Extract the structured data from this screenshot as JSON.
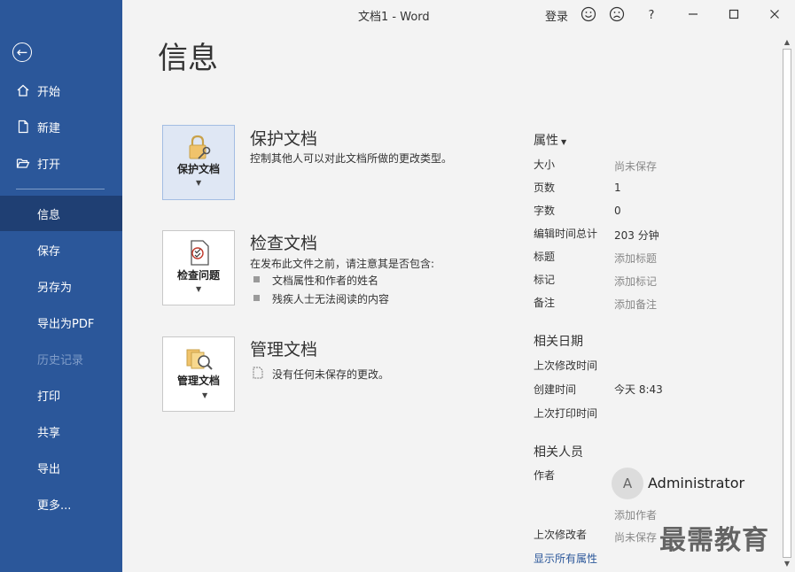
{
  "window": {
    "title": "文档1 - Word",
    "login": "登录"
  },
  "sidebar": {
    "items": [
      {
        "label": "开始"
      },
      {
        "label": "新建"
      },
      {
        "label": "打开"
      },
      {
        "label": "信息"
      },
      {
        "label": "保存"
      },
      {
        "label": "另存为"
      },
      {
        "label": "导出为PDF"
      },
      {
        "label": "历史记录"
      },
      {
        "label": "打印"
      },
      {
        "label": "共享"
      },
      {
        "label": "导出"
      },
      {
        "label": "更多..."
      }
    ]
  },
  "page": {
    "title": "信息"
  },
  "sections": {
    "protect": {
      "button": "保护文档",
      "title": "保护文档",
      "desc": "控制其他人可以对此文档所做的更改类型。"
    },
    "inspect": {
      "button": "检查问题",
      "title": "检查文档",
      "desc": "在发布此文件之前，请注意其是否包含:",
      "bullets": [
        "文档属性和作者的姓名",
        "残疾人士无法阅读的内容"
      ]
    },
    "manage": {
      "button": "管理文档",
      "title": "管理文档",
      "desc": "没有任何未保存的更改。"
    }
  },
  "properties": {
    "header": "属性",
    "rows": [
      {
        "label": "大小",
        "value": "尚未保存"
      },
      {
        "label": "页数",
        "value": "1"
      },
      {
        "label": "字数",
        "value": "0"
      },
      {
        "label": "编辑时间总计",
        "value": "203 分钟"
      },
      {
        "label": "标题",
        "value": "添加标题"
      },
      {
        "label": "标记",
        "value": "添加标记"
      },
      {
        "label": "备注",
        "value": "添加备注"
      }
    ]
  },
  "dates": {
    "header": "相关日期",
    "rows": [
      {
        "label": "上次修改时间",
        "value": ""
      },
      {
        "label": "创建时间",
        "value": "今天 8:43"
      },
      {
        "label": "上次打印时间",
        "value": ""
      }
    ]
  },
  "people": {
    "header": "相关人员",
    "author_label": "作者",
    "avatar_letter": "A",
    "author_name": "Administrator",
    "add_author": "添加作者",
    "last_modified_label": "上次修改者",
    "last_modified_value": "尚未保存"
  },
  "show_all": "显示所有属性",
  "watermark": "最需教育",
  "colors": {
    "sidebar": "#2b579a",
    "active": "#1f3f73",
    "link": "#2b579a"
  }
}
